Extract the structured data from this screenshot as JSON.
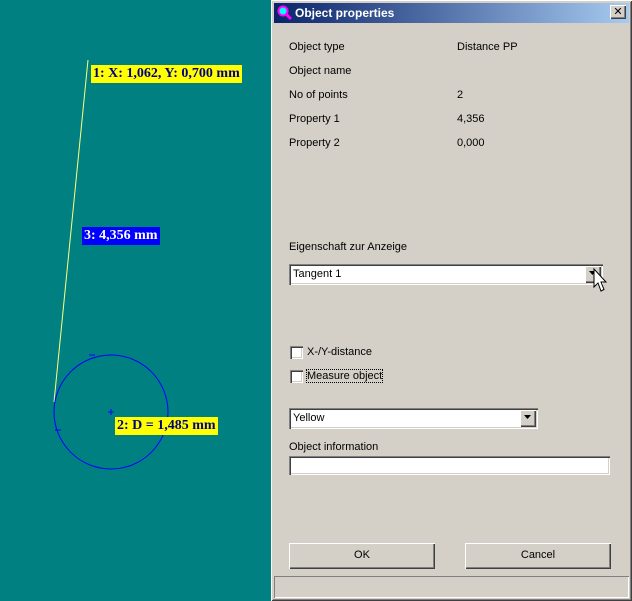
{
  "canvas": {
    "label_point1": "1: X: 1,062, Y: 0,700 mm",
    "label_distance": "3: 4,356 mm",
    "label_circle": "2: D = 1,485  mm",
    "colors": {
      "background": "#008080",
      "line": "#ffff80",
      "circle": "#0000ff"
    }
  },
  "dialog": {
    "title": "Object properties",
    "close_glyph": "✕",
    "properties": [
      {
        "key": "Object type",
        "value": "Distance PP"
      },
      {
        "key": "Object name",
        "value": ""
      },
      {
        "key": "No of points",
        "value": "2"
      },
      {
        "key": "Property 1",
        "value": "4,356"
      },
      {
        "key": "Property 2",
        "value": "0,000"
      }
    ],
    "display_property_label": "Eigenschaft zur Anzeige",
    "display_property_value": "Tangent 1",
    "checkbox_xy": "X-/Y-distance",
    "checkbox_measure": "Measure object",
    "color_value": "Yellow",
    "object_info_label": "Object information",
    "object_info_value": "",
    "ok_label": "OK",
    "cancel_label": "Cancel"
  }
}
